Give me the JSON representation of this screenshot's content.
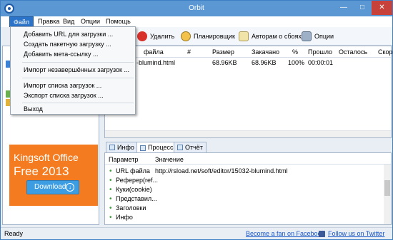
{
  "window": {
    "title": "Orbit",
    "min": "—",
    "max": "□",
    "close": "✕"
  },
  "menubar": {
    "items": [
      {
        "label": "Файл"
      },
      {
        "label": "Правка"
      },
      {
        "label": "Вид"
      },
      {
        "label": "Опции"
      },
      {
        "label": "Помощь"
      }
    ]
  },
  "file_menu": {
    "items": [
      {
        "label": "Добавить URL для загрузки ..."
      },
      {
        "label": "Создать пакетную загрузку ..."
      },
      {
        "label": "Добавить мета-ссылку ..."
      },
      {
        "label": "Импорт незавершённых загрузок ..."
      },
      {
        "label": "Импорт списка загрузок ..."
      },
      {
        "label": "Экспорт списка загрузок ..."
      },
      {
        "label": "Выход"
      }
    ]
  },
  "toolbar": {
    "delete": "Удалить",
    "scheduler": "Планировщик",
    "authors": "Авторам о сбоях",
    "options": "Опции"
  },
  "downloads": {
    "columns": {
      "name": "файла",
      "num": "#",
      "size": "Размер",
      "done": "Закачано",
      "pct": "%",
      "elapsed": "Прошло",
      "remain": "Осталось",
      "speed": "Скор"
    },
    "rows": [
      {
        "name": "-blumind.html",
        "size": "68.96KB",
        "done": "68.96KB",
        "pct": "100%",
        "elapsed": "00:00:01"
      }
    ]
  },
  "ad": {
    "brand": "Kingsoft Office",
    "free": "Free 2013",
    "download": "Download"
  },
  "tabs": [
    {
      "label": "Инфо"
    },
    {
      "label": "Процесс"
    },
    {
      "label": "Отчёт"
    }
  ],
  "details": {
    "columns": {
      "param": "Параметр",
      "value": "Значение"
    },
    "rows": [
      {
        "param": "URL файла",
        "value": "http://rsload.net/soft/editor/15032-blumind.html"
      },
      {
        "param": "Реферер(ref...",
        "value": ""
      },
      {
        "param": "Куки(cookie)",
        "value": ""
      },
      {
        "param": "Представил...",
        "value": ""
      },
      {
        "param": "Заголовки",
        "value": ""
      },
      {
        "param": "Инфо",
        "value": ""
      }
    ]
  },
  "status": {
    "text": "Ready",
    "facebook": "Become a fan on Facebook",
    "twitter": "Follow us on Twitter"
  }
}
